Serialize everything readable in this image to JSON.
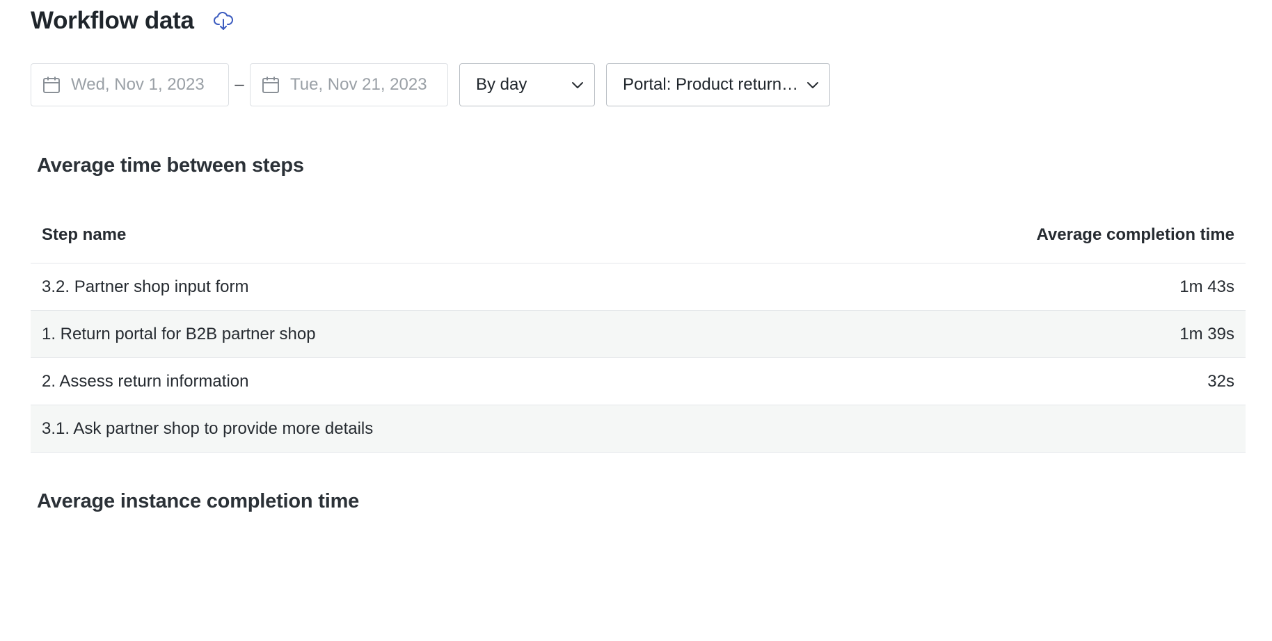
{
  "page": {
    "title": "Workflow data"
  },
  "filters": {
    "start_date_placeholder": "Wed, Nov 1, 2023",
    "range_separator": "–",
    "end_date_placeholder": "Tue, Nov 21, 2023",
    "granularity": "By day",
    "workflow": "Portal: Product return…"
  },
  "steps_section": {
    "title": "Average time between steps",
    "columns": {
      "step_name": "Step name",
      "avg_time": "Average completion time"
    },
    "rows": [
      {
        "name": "3.2. Partner shop input form",
        "time": "1m 43s"
      },
      {
        "name": "1. Return portal for B2B partner shop",
        "time": "1m 39s"
      },
      {
        "name": "2. Assess return information",
        "time": "32s"
      },
      {
        "name": "3.1. Ask partner shop to provide more details",
        "time": ""
      }
    ]
  },
  "completion_section": {
    "title": "Average instance completion time"
  },
  "colors": {
    "icon_accent": "#3b5bbf",
    "row_alt_bg": "#f5f7f6"
  },
  "icons": {
    "download": "cloud-download-icon",
    "calendar": "calendar-icon",
    "chevron": "chevron-down-icon"
  }
}
